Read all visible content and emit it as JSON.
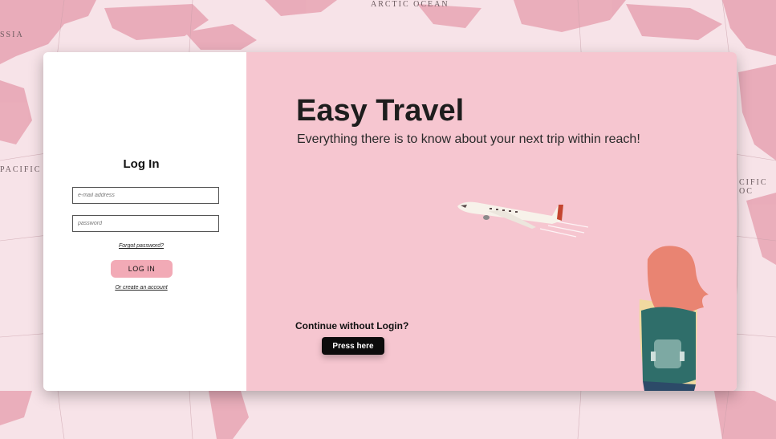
{
  "background": {
    "map_labels": {
      "arctic_ocean": "ARCTIC OCEAN",
      "pacific_left": "PACIFIC O",
      "pacific_right": "CIFIC OC",
      "russia": "SSIA"
    }
  },
  "login": {
    "title": "Log In",
    "email_placeholder": "e-mail address",
    "password_placeholder": "password",
    "forgot_label": "Forgot password?",
    "login_button": "LOG IN",
    "create_account_label": "Or create an account"
  },
  "hero": {
    "title": "Easy Travel",
    "subtitle": "Everything there is to know about your next trip within reach!",
    "continue_label": "Continue without Login?",
    "press_button": "Press here"
  },
  "colors": {
    "hero_bg": "#f6c6d0",
    "login_button_bg": "#f2aab6",
    "press_button_bg": "#0c0c0c",
    "map_tint": "#e8a7b6"
  },
  "icons": {
    "plane": "airplane-icon",
    "traveler": "traveler-illustration"
  }
}
